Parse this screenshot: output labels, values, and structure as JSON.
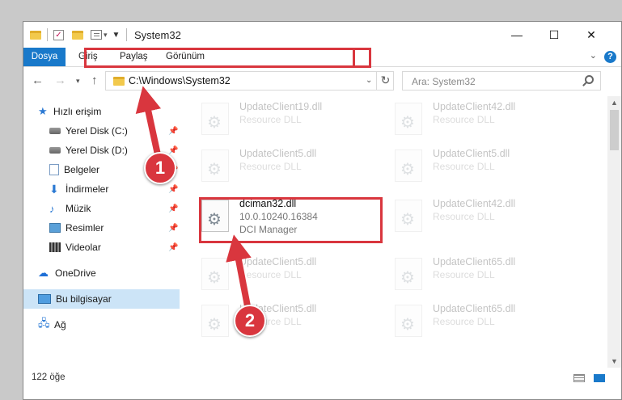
{
  "window": {
    "title": "System32"
  },
  "ribbon": {
    "tabs": [
      "Dosya",
      "Giriş",
      "Paylaş",
      "Görünüm"
    ]
  },
  "nav": {
    "address": "C:\\Windows\\System32",
    "search_placeholder": "Ara: System32"
  },
  "sidebar": {
    "items": [
      {
        "label": "Hızlı erişim",
        "icon": "star-icon",
        "pinned": false
      },
      {
        "label": "Yerel Disk (C:)",
        "icon": "drive-icon",
        "pinned": true
      },
      {
        "label": "Yerel Disk (D:)",
        "icon": "drive-icon",
        "pinned": true
      },
      {
        "label": "Belgeler",
        "icon": "documents-icon",
        "pinned": true
      },
      {
        "label": "İndirmeler",
        "icon": "downloads-icon",
        "pinned": true
      },
      {
        "label": "Müzik",
        "icon": "music-icon",
        "pinned": true
      },
      {
        "label": "Resimler",
        "icon": "pictures-icon",
        "pinned": true
      },
      {
        "label": "Videolar",
        "icon": "videos-icon",
        "pinned": true
      },
      {
        "label": "OneDrive",
        "icon": "onedrive-icon",
        "pinned": false
      },
      {
        "label": "Bu bilgisayar",
        "icon": "this-pc-icon",
        "pinned": false,
        "selected": true
      },
      {
        "label": "Ağ",
        "icon": "network-icon",
        "pinned": false
      }
    ]
  },
  "files": [
    {
      "name": "UpdateClient19.dll",
      "line1": "Resource DLL",
      "line2": ""
    },
    {
      "name": "UpdateClient42.dll",
      "line1": "Resource DLL",
      "line2": ""
    },
    {
      "name": "UpdateClient5.dll",
      "line1": "Resource DLL",
      "line2": ""
    },
    {
      "name": "UpdateClient5.dll",
      "line1": "Resource DLL",
      "line2": ""
    },
    {
      "name": "dciman32.dll",
      "line1": "10.0.10240.16384",
      "line2": "DCI Manager",
      "highlighted": true
    },
    {
      "name": "UpdateClient42.dll",
      "line1": "Resource DLL",
      "line2": ""
    },
    {
      "name": "UpdateClient5.dll",
      "line1": "Resource DLL",
      "line2": ""
    },
    {
      "name": "UpdateClient65.dll",
      "line1": "Resource DLL",
      "line2": ""
    },
    {
      "name": "UpdateClient5.dll",
      "line1": "Resource DLL",
      "line2": ""
    },
    {
      "name": "UpdateClient65.dll",
      "line1": "Resource DLL",
      "line2": ""
    }
  ],
  "status": {
    "count": "122 öğe"
  },
  "callouts": [
    "1",
    "2"
  ],
  "colors": {
    "accent": "#1979ca",
    "highlight": "#d9363e",
    "selection": "#cce4f7"
  }
}
